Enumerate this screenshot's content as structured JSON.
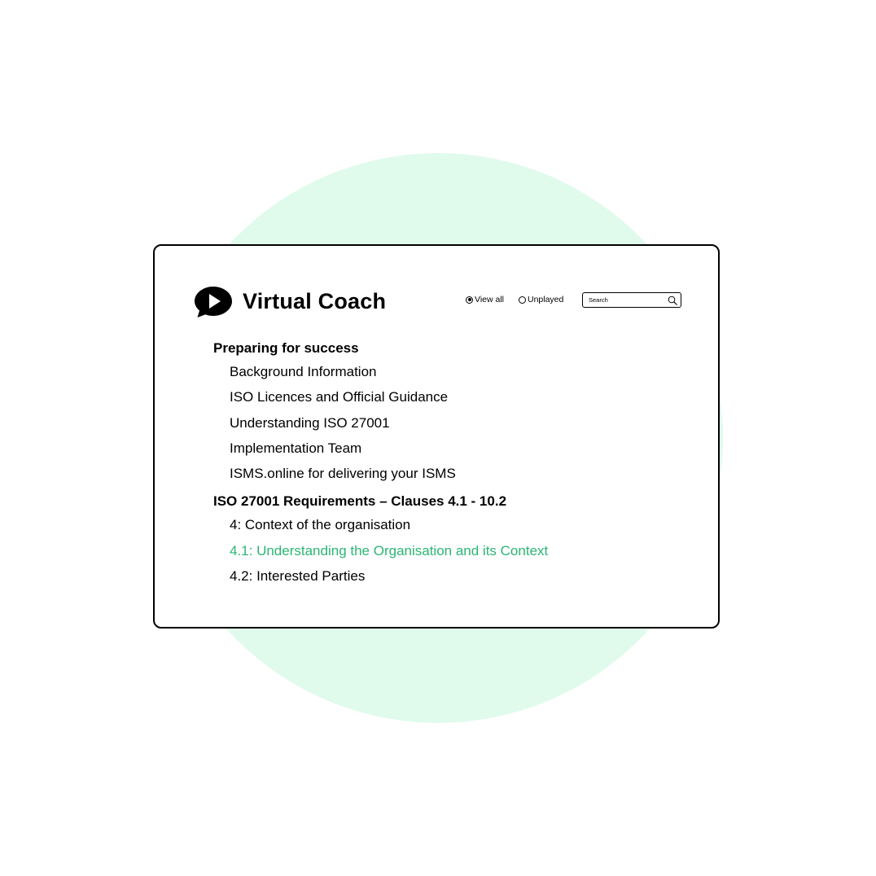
{
  "theme": {
    "accent": "#2bb673",
    "circle_bg": "#e0fbec",
    "text": "#000000"
  },
  "header": {
    "logo_icon": "play-speech-bubble-icon",
    "app_title": "Virtual Coach"
  },
  "filters": {
    "options": [
      {
        "label": "View all",
        "selected": true
      },
      {
        "label": "Unplayed",
        "selected": false
      }
    ]
  },
  "search": {
    "placeholder": "Search",
    "icon": "search-icon"
  },
  "sections": [
    {
      "heading": "Preparing for success",
      "items": [
        {
          "label": "Background Information",
          "active": false
        },
        {
          "label": "ISO Licences and Official Guidance",
          "active": false
        },
        {
          "label": "Understanding ISO 27001",
          "active": false
        },
        {
          "label": "Implementation Team",
          "active": false
        },
        {
          "label": "ISMS.online for delivering your ISMS",
          "active": false
        }
      ]
    },
    {
      "heading": "ISO 27001 Requirements – Clauses 4.1 - 10.2",
      "items": [
        {
          "label": "4: Context of the organisation",
          "active": false
        },
        {
          "label": "4.1: Understanding the Organisation and its Context",
          "active": true
        },
        {
          "label": "4.2: Interested Parties",
          "active": false
        }
      ]
    }
  ]
}
